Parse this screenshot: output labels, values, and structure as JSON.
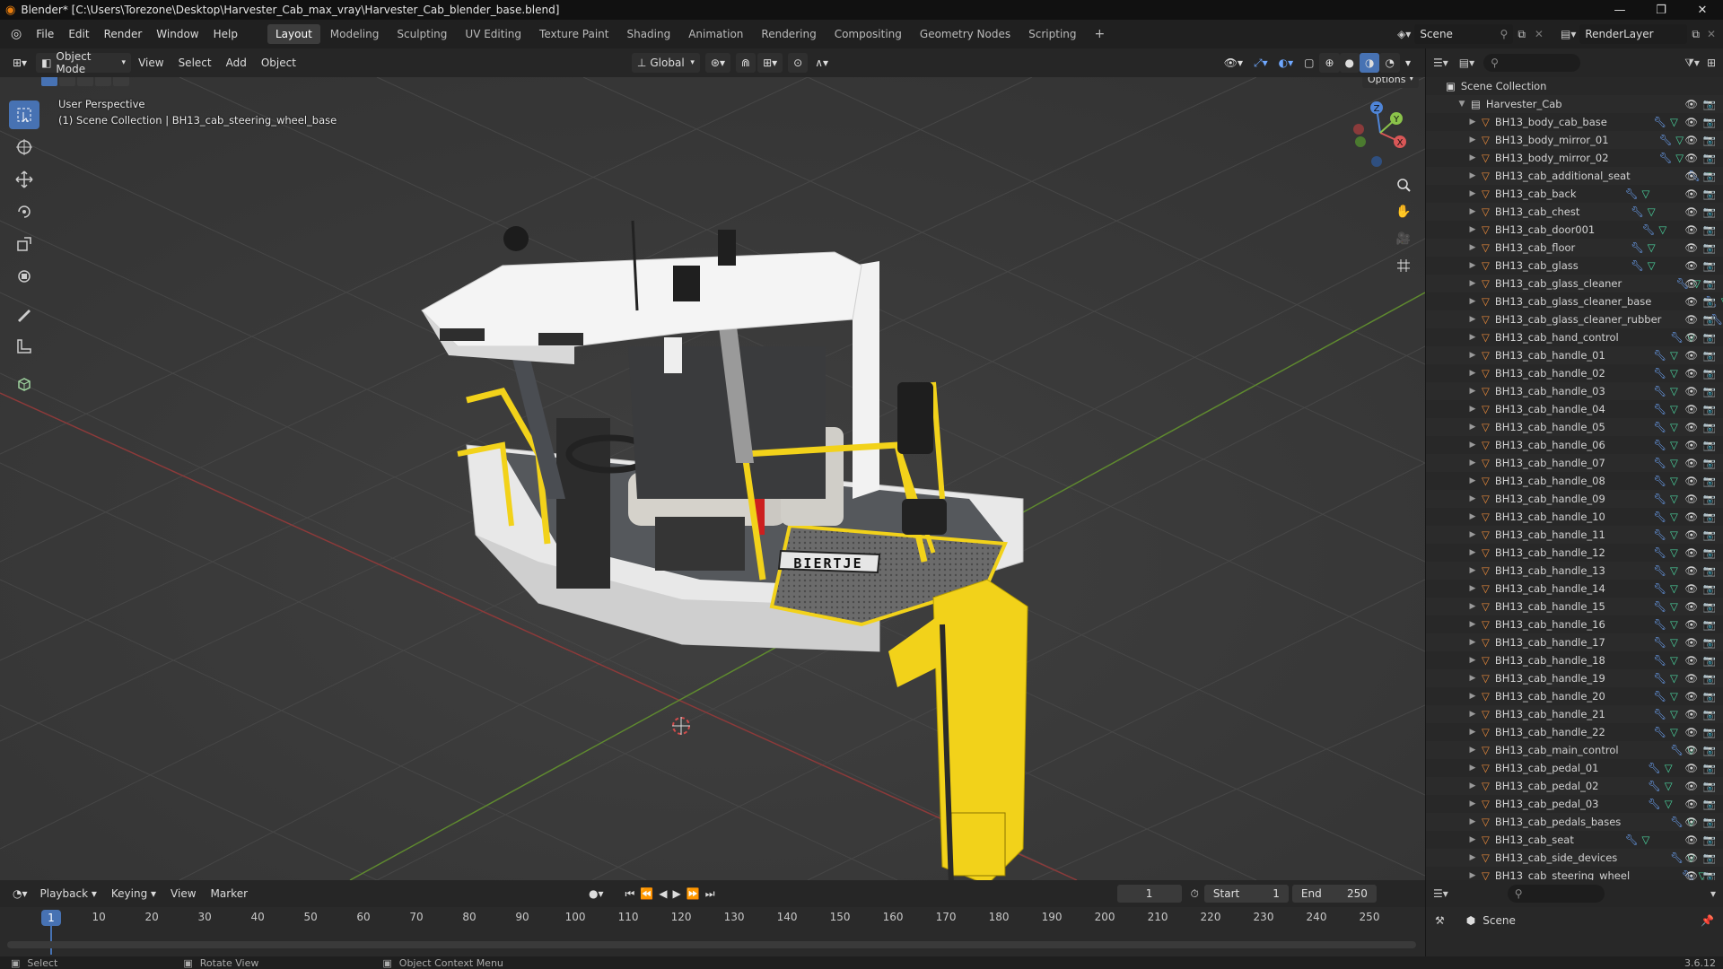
{
  "window": {
    "title": "Blender* [C:\\Users\\Torezone\\Desktop\\Harvester_Cab_max_vray\\Harvester_Cab_blender_base.blend]"
  },
  "menu": {
    "items": [
      "File",
      "Edit",
      "Render",
      "Window",
      "Help"
    ],
    "workspaces": [
      "Layout",
      "Modeling",
      "Sculpting",
      "UV Editing",
      "Texture Paint",
      "Shading",
      "Animation",
      "Rendering",
      "Compositing",
      "Geometry Nodes",
      "Scripting"
    ],
    "active_workspace": "Layout",
    "scene": "Scene",
    "view_layer": "RenderLayer"
  },
  "viewport_header": {
    "mode": "Object Mode",
    "menus": [
      "View",
      "Select",
      "Add",
      "Object"
    ],
    "transform_orientation": "Global",
    "options": "Options"
  },
  "viewport": {
    "perspective": "User Perspective",
    "context": "(1) Scene Collection | BH13_cab_steering_wheel_base",
    "sign_text": "BIERTJE"
  },
  "outliner": {
    "root": "Scene Collection",
    "collection": "Harvester_Cab",
    "objects": [
      "BH13_body_cab_base",
      "BH13_body_mirror_01",
      "BH13_body_mirror_02",
      "BH13_cab_additional_seat",
      "BH13_cab_back",
      "BH13_cab_chest",
      "BH13_cab_door001",
      "BH13_cab_floor",
      "BH13_cab_glass",
      "BH13_cab_glass_cleaner",
      "BH13_cab_glass_cleaner_base",
      "BH13_cab_glass_cleaner_rubber",
      "BH13_cab_hand_control",
      "BH13_cab_handle_01",
      "BH13_cab_handle_02",
      "BH13_cab_handle_03",
      "BH13_cab_handle_04",
      "BH13_cab_handle_05",
      "BH13_cab_handle_06",
      "BH13_cab_handle_07",
      "BH13_cab_handle_08",
      "BH13_cab_handle_09",
      "BH13_cab_handle_10",
      "BH13_cab_handle_11",
      "BH13_cab_handle_12",
      "BH13_cab_handle_13",
      "BH13_cab_handle_14",
      "BH13_cab_handle_15",
      "BH13_cab_handle_16",
      "BH13_cab_handle_17",
      "BH13_cab_handle_18",
      "BH13_cab_handle_19",
      "BH13_cab_handle_20",
      "BH13_cab_handle_21",
      "BH13_cab_handle_22",
      "BH13_cab_main_control",
      "BH13_cab_pedal_01",
      "BH13_cab_pedal_02",
      "BH13_cab_pedal_03",
      "BH13_cab_pedals_bases",
      "BH13_cab_seat",
      "BH13_cab_side_devices",
      "BH13_cab_steering_wheel"
    ]
  },
  "timeline": {
    "menus": [
      "Playback",
      "Keying",
      "View",
      "Marker"
    ],
    "current_frame": "1",
    "start_label": "Start",
    "start": "1",
    "end_label": "End",
    "end": "250",
    "ticks": [
      "1",
      "10",
      "20",
      "30",
      "40",
      "50",
      "60",
      "70",
      "80",
      "90",
      "100",
      "110",
      "120",
      "130",
      "140",
      "150",
      "160",
      "170",
      "180",
      "190",
      "200",
      "210",
      "220",
      "230",
      "240",
      "250"
    ]
  },
  "properties": {
    "scene_label": "Scene"
  },
  "statusbar": {
    "select": "Select",
    "rotate": "Rotate View",
    "context_menu": "Object Context Menu",
    "version": "3.6.12"
  },
  "colors": {
    "accent": "#4772b3",
    "object_icon": "#e8893a",
    "modifier_icon": "#6fa8ff",
    "mesh_icon": "#4bd6a0",
    "cab_yellow": "#f2d21a"
  }
}
